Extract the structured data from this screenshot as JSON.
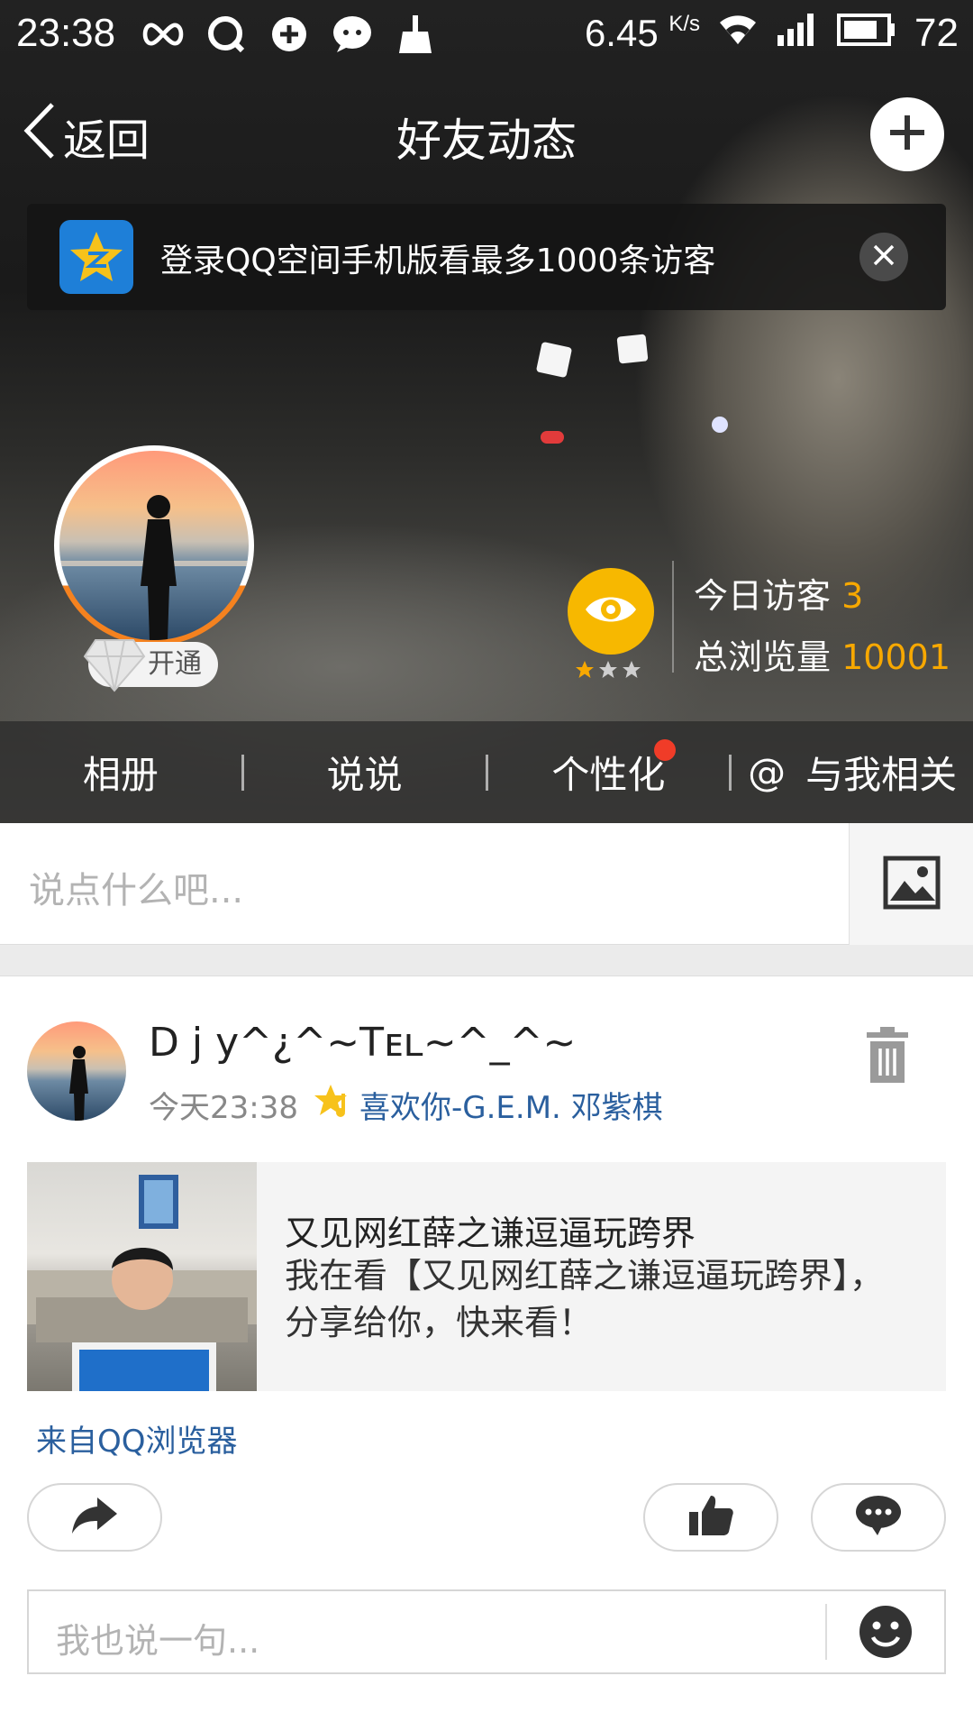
{
  "status_bar": {
    "time": "23:38",
    "net_speed": "6.45",
    "net_unit": "K/s",
    "battery": "72",
    "icons": [
      "infinity-icon",
      "qq-icon",
      "sync-icon",
      "chat-icon",
      "broom-icon",
      "wifi-icon",
      "signal-icon",
      "battery-icon"
    ]
  },
  "nav": {
    "back_label": "返回",
    "title": "好友动态"
  },
  "banner": {
    "text": "登录QQ空间手机版看最多1000条访客"
  },
  "profile": {
    "vip_label": "开通",
    "visitors_today_label": "今日访客",
    "visitors_today": "3",
    "total_views_label": "总浏览量",
    "total_views": "10001"
  },
  "tabs": [
    {
      "label": "相册"
    },
    {
      "label": "说说"
    },
    {
      "label": "个性化",
      "badge": true
    },
    {
      "label": "与我相关",
      "prefix": "@"
    }
  ],
  "composer": {
    "placeholder": "说点什么吧..."
  },
  "post": {
    "author": "D j y^¿^~Tᴇʟ~^_^~",
    "time": "今天23:38",
    "music": "喜欢你-G.E.M. 邓紫棋",
    "share_title": "又见网红薛之谦逗逼玩跨界",
    "share_desc": "我在看【又见网红薛之谦逗逼玩跨界】，分享给你，快来看！",
    "source": "来自QQ浏览器",
    "reply_placeholder": "我也说一句..."
  },
  "colors": {
    "accent_orange": "#f7a800",
    "link_blue": "#2a5f9e",
    "badge_red": "#f03c28",
    "qzone_blue": "#1e7fd8"
  }
}
